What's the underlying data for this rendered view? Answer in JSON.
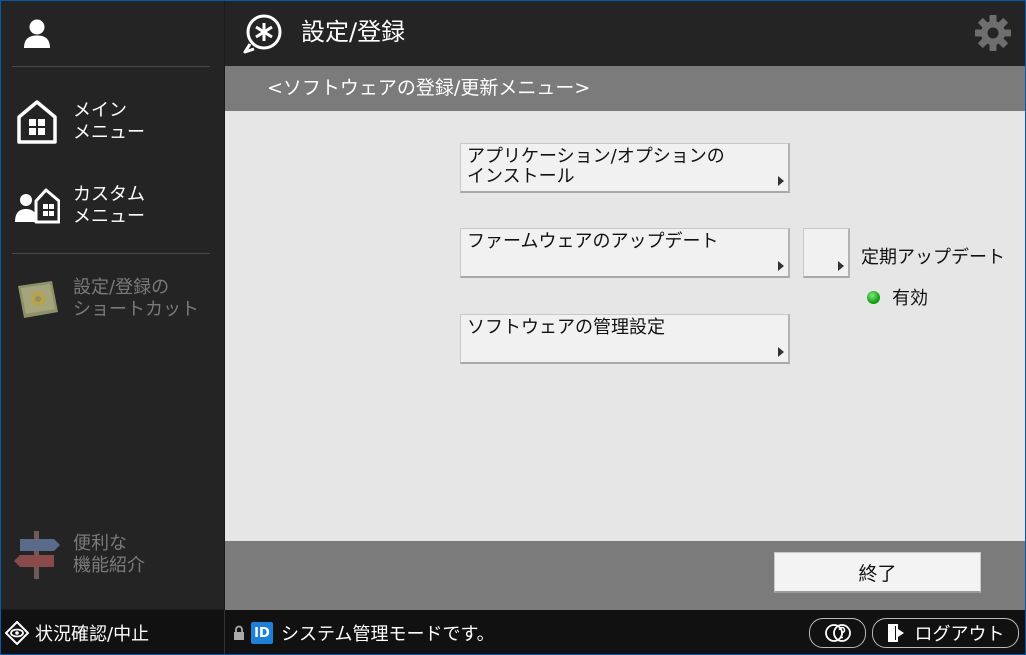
{
  "header": {
    "title": "設定/登録"
  },
  "sidebar": {
    "items": [
      {
        "label": "メイン\nメニュー"
      },
      {
        "label": "カスタム\nメニュー"
      },
      {
        "label": "設定/登録の\nショートカット"
      },
      {
        "label": "便利な\n機能紹介"
      }
    ]
  },
  "subheader": {
    "title": "<ソフトウェアの登録/更新メニュー>"
  },
  "main": {
    "buttons": [
      {
        "label": "アプリケーション/オプションの\nインストール"
      },
      {
        "label": "ファームウェアのアップデート"
      },
      {
        "label": "ソフトウェアの管理設定"
      }
    ],
    "periodic_update": {
      "label": "定期アップデート",
      "status": "有効",
      "status_color": "#16a316"
    },
    "end_label": "終了"
  },
  "statusbar": {
    "left_label": "状況確認/中止",
    "id_badge": "ID",
    "message": "システム管理モードです。",
    "logout_label": "ログアウト"
  },
  "colors": {
    "accent_blue": "#1e7fd6",
    "frame_blue": "#0a58a8"
  }
}
